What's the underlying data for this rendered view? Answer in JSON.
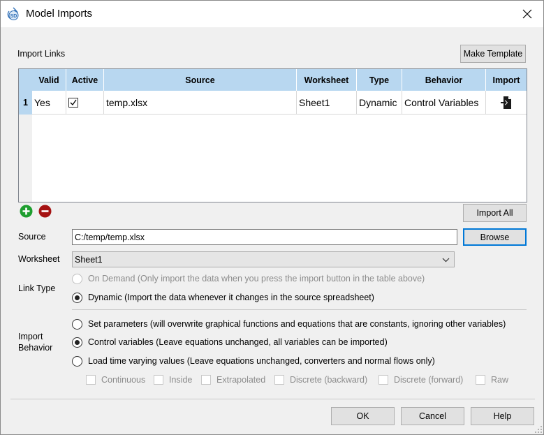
{
  "window": {
    "title": "Model Imports",
    "icon": "app-icon",
    "close_icon": "close-icon"
  },
  "import_links_label": "Import Links",
  "buttons": {
    "make_template": "Make Template",
    "import_all": "Import All",
    "browse": "Browse",
    "ok": "OK",
    "cancel": "Cancel",
    "help": "Help"
  },
  "table": {
    "columns": [
      "Valid",
      "Active",
      "Source",
      "Worksheet",
      "Type",
      "Behavior",
      "Import"
    ],
    "rows": [
      {
        "num": "1",
        "valid": "Yes",
        "active": true,
        "source": "temp.xlsx",
        "worksheet": "Sheet1",
        "type": "Dynamic",
        "behavior": "Control Variables",
        "import_icon": "import-file-icon"
      }
    ]
  },
  "add_icon": "add-icon",
  "remove_icon": "remove-icon",
  "source": {
    "label": "Source",
    "value": "C:/temp/temp.xlsx"
  },
  "worksheet": {
    "label": "Worksheet",
    "value": "Sheet1"
  },
  "link_type": {
    "label": "Link Type",
    "options": [
      {
        "label": "On Demand (Only import the data when you press the import button in the table above)",
        "selected": false,
        "enabled": false
      },
      {
        "label": "Dynamic (Import the data whenever it changes in the source spreadsheet)",
        "selected": true,
        "enabled": true
      }
    ]
  },
  "import_behavior": {
    "label_line1": "Import",
    "label_line2": "Behavior",
    "options": [
      {
        "label": "Set parameters (will overwrite graphical functions and equations that are constants, ignoring other variables)",
        "selected": false
      },
      {
        "label": "Control variables (Leave equations unchanged, all variables can be imported)",
        "selected": true
      },
      {
        "label": "Load time varying values (Leave equations unchanged, converters and normal flows only)",
        "selected": false
      }
    ],
    "checkboxes": [
      "Continuous",
      "Inside",
      "Extrapolated",
      "Discrete (backward)",
      "Discrete (forward)",
      "Raw"
    ]
  }
}
